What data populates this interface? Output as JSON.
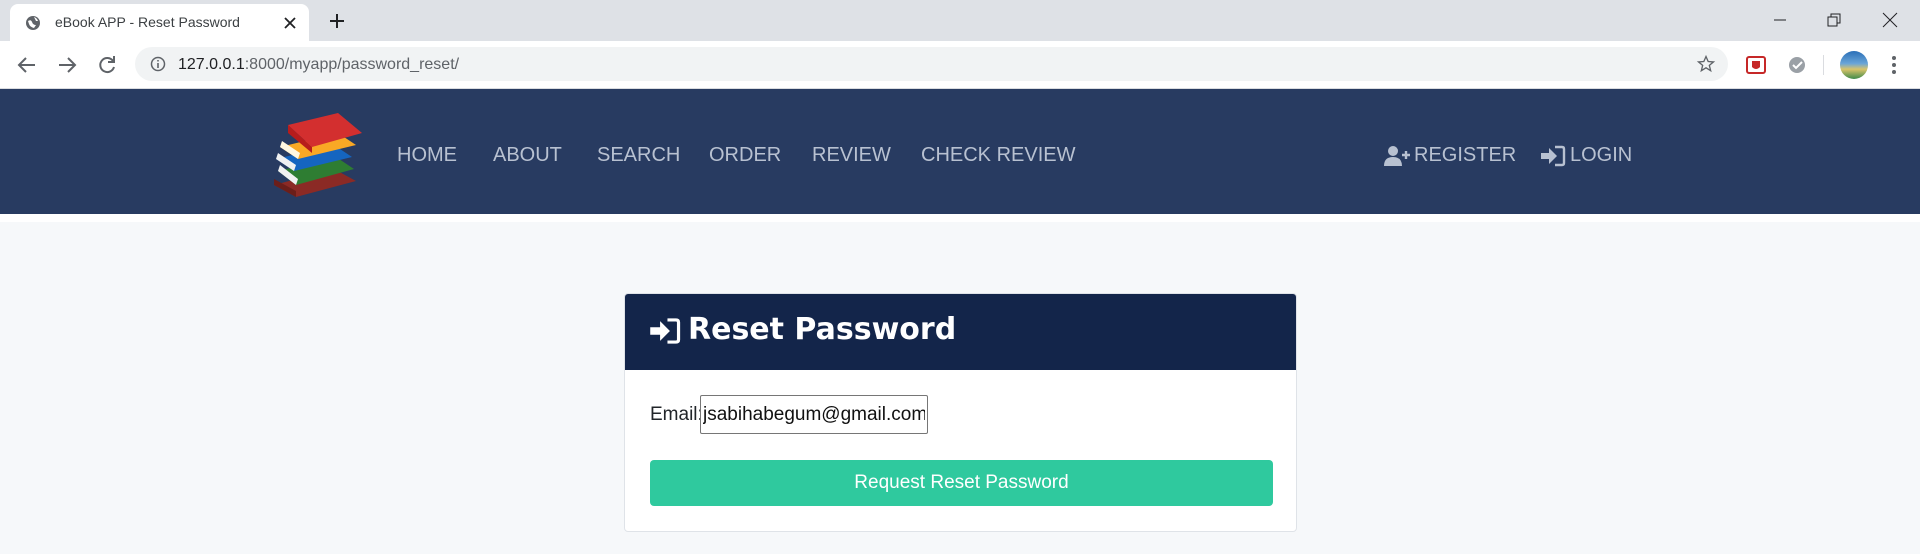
{
  "browser": {
    "tab_title": "eBook APP - Reset Password",
    "url_host": "127.0.0.1",
    "url_rest": ":8000/myapp/password_reset/"
  },
  "navbar": {
    "links": [
      "HOME",
      "ABOUT",
      "SEARCH",
      "ORDER",
      "REVIEW",
      "CHECK REVIEW"
    ],
    "register_label": "REGISTER",
    "login_label": "LOGIN"
  },
  "card": {
    "title": "Reset Password",
    "email_label": "Email:",
    "email_value": "jsabihabegum@gmail.com",
    "submit_label": "Request Reset Password"
  },
  "colors": {
    "navbar_bg": "#283b61",
    "card_header_bg": "#13254a",
    "button_bg": "#2fc99e",
    "page_bg": "#f6f8fa"
  },
  "icons": [
    "globe-icon",
    "close-icon",
    "plus-icon",
    "back-icon",
    "forward-icon",
    "reload-icon",
    "info-icon",
    "star-icon",
    "kebab-menu-icon",
    "books-logo",
    "user-plus-icon",
    "sign-in-icon"
  ]
}
